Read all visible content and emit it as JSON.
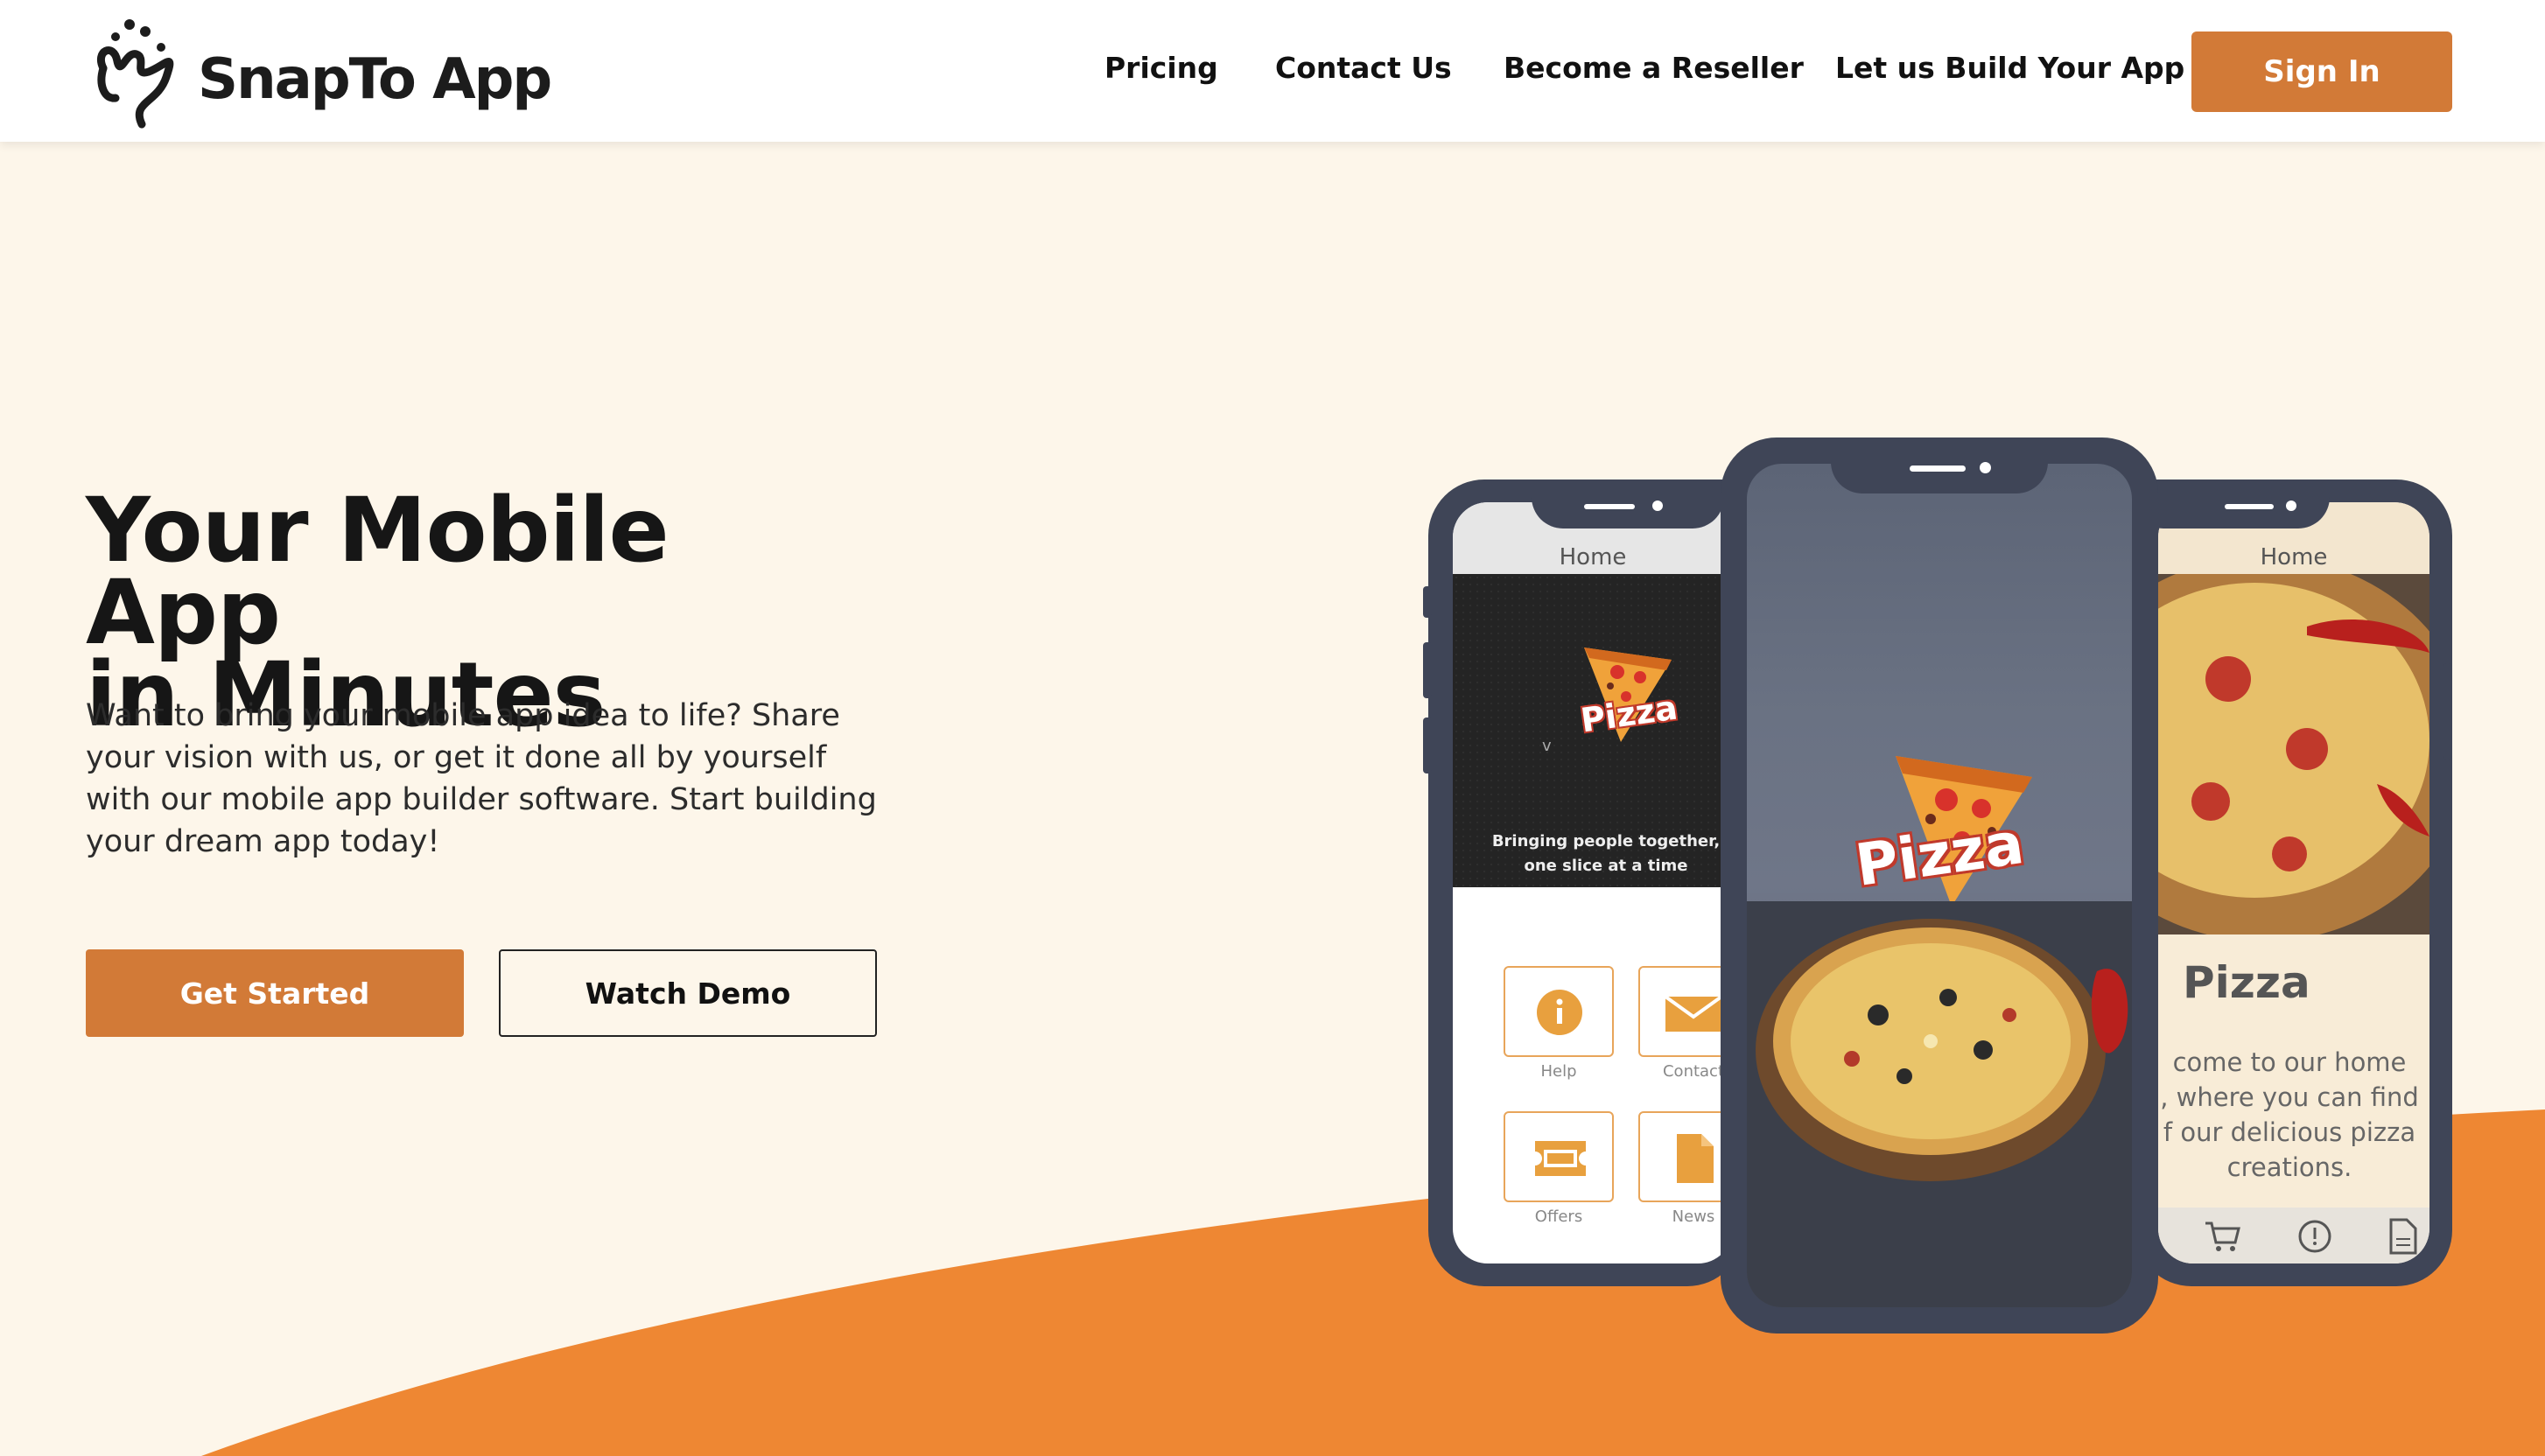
{
  "brand": {
    "name": "SnapTo App",
    "accent": "#d27a37",
    "wave_color": "#ee8733"
  },
  "nav": {
    "items": [
      {
        "label": "Pricing"
      },
      {
        "label": "Contact Us"
      },
      {
        "label": "Become a Reseller"
      },
      {
        "label": "Let us Build Your App"
      }
    ],
    "signin_label": "Sign In"
  },
  "hero": {
    "title_line1": "Your Mobile App",
    "title_line2": "in Minutes",
    "description": "Want to bring your mobile app idea to life? Share your vision with us, or get it done all by yourself with our mobile app builder software. Start building your dream app today!",
    "primary_button": "Get Started",
    "secondary_button": "Watch Demo"
  },
  "phones": {
    "left": {
      "header": "Home",
      "logo_text": "Pizza",
      "tagline": "Bringing people together, one slice at a time",
      "tiles": [
        {
          "label": "Help",
          "icon": "info-icon"
        },
        {
          "label": "Contact",
          "icon": "mail-icon"
        },
        {
          "label": "Offers",
          "icon": "ticket-icon"
        },
        {
          "label": "News",
          "icon": "document-icon"
        }
      ]
    },
    "center": {
      "logo_text": "Pizza"
    },
    "right": {
      "header": "Home",
      "title": "Pizza",
      "text_lines": [
        "come to our home",
        ", where you can find",
        "f our delicious pizza",
        "creations."
      ],
      "bottom_icons": [
        "cart-icon",
        "alert-icon",
        "document-icon"
      ]
    }
  }
}
